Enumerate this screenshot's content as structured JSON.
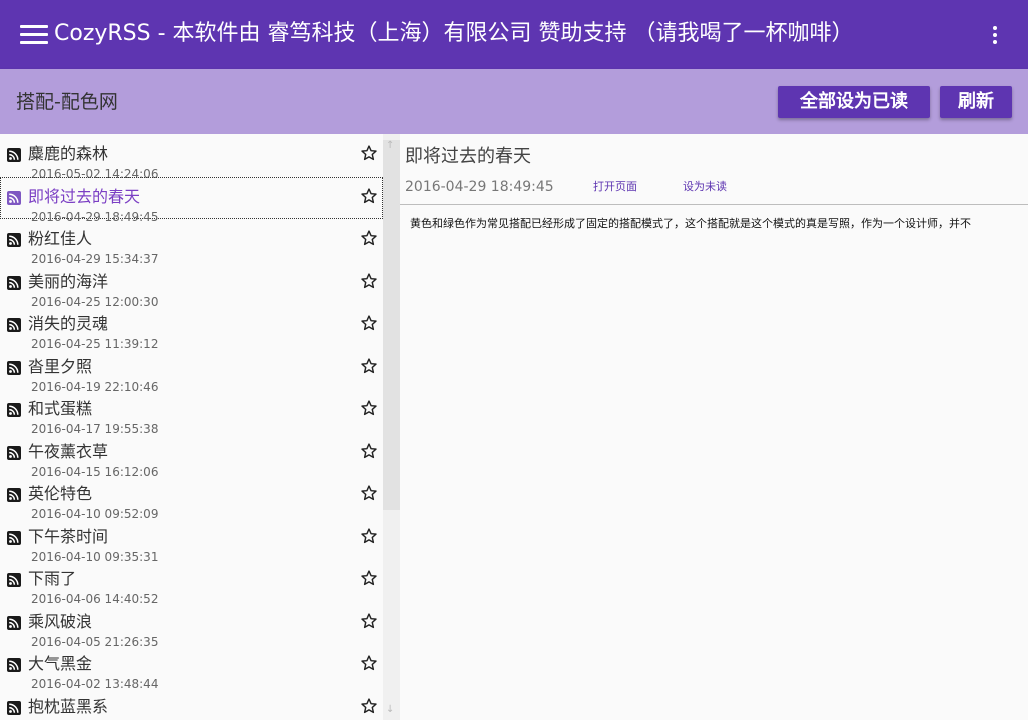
{
  "app": {
    "title": "CozyRSS - 本软件由 睿笃科技（上海）有限公司 赞助支持 （请我喝了一杯咖啡）"
  },
  "feed": {
    "title": "搭配-配色网",
    "mark_all_read_label": "全部设为已读",
    "refresh_label": "刷新"
  },
  "items": [
    {
      "title": "麋鹿的森林",
      "date": "2016-05-02 14:24:06"
    },
    {
      "title": "即将过去的春天",
      "date": "2016-04-29 18:49:45"
    },
    {
      "title": "粉红佳人",
      "date": "2016-04-29 15:34:37"
    },
    {
      "title": "美丽的海洋",
      "date": "2016-04-25 12:00:30"
    },
    {
      "title": "消失的灵魂",
      "date": "2016-04-25 11:39:12"
    },
    {
      "title": "沓里夕照",
      "date": "2016-04-19 22:10:46"
    },
    {
      "title": "和式蛋糕",
      "date": "2016-04-17 19:55:38"
    },
    {
      "title": "午夜薰衣草",
      "date": "2016-04-15 16:12:06"
    },
    {
      "title": "英伦特色",
      "date": "2016-04-10 09:52:09"
    },
    {
      "title": "下午茶时间",
      "date": "2016-04-10 09:35:31"
    },
    {
      "title": "下雨了",
      "date": "2016-04-06 14:40:52"
    },
    {
      "title": "乘风破浪",
      "date": "2016-04-05 21:26:35"
    },
    {
      "title": "大气黑金",
      "date": "2016-04-02 13:48:44"
    },
    {
      "title": "抱枕蓝黑系",
      "date": ""
    }
  ],
  "selected_index": 1,
  "article": {
    "title": "即将过去的春天",
    "date": "2016-04-29 18:49:45",
    "open_page_label": "打开页面",
    "mark_unread_label": "设为未读",
    "body": "黄色和绿色作为常见搭配已经形成了固定的搭配模式了，这个搭配就是这个模式的真是写照，作为一个设计师，并不"
  },
  "colors": {
    "primary": "#5e35b1",
    "toolbar": "#b39ddb",
    "selected_text": "#7b3fc4"
  },
  "icons": {
    "menu": "menu-icon",
    "overflow": "more-vert-icon",
    "item": "rss-icon",
    "favorite": "star-outline-icon"
  }
}
